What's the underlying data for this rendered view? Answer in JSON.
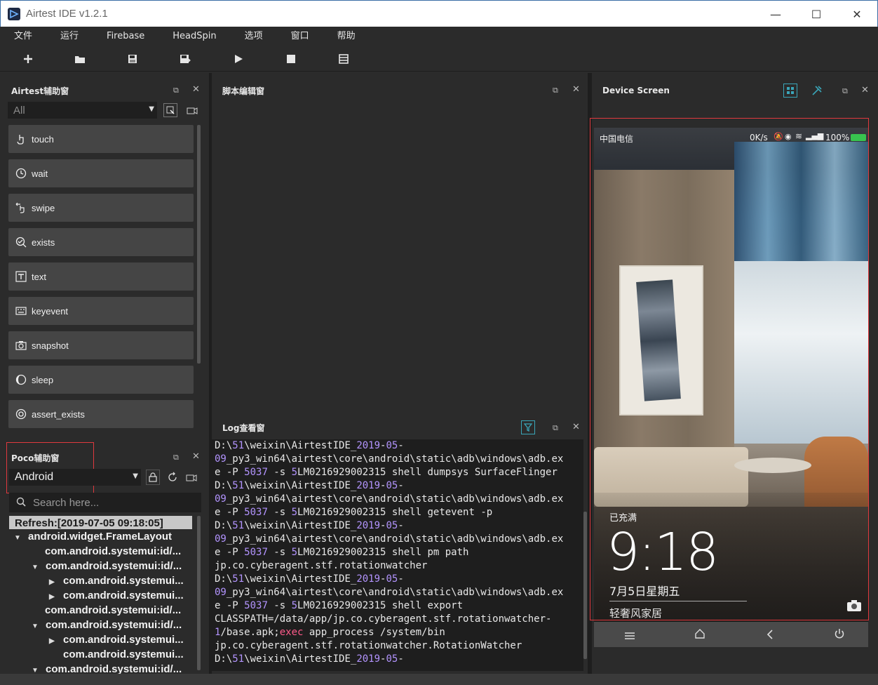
{
  "window": {
    "title": "Airtest IDE v1.2.1"
  },
  "menu": [
    "文件",
    "运行",
    "Firebase",
    "HeadSpin",
    "选项",
    "窗口",
    "帮助"
  ],
  "airtest_panel": {
    "title": "Airtest辅助窗",
    "filter_value": "All",
    "items": [
      "touch",
      "wait",
      "swipe",
      "exists",
      "text",
      "keyevent",
      "snapshot",
      "sleep",
      "assert_exists"
    ]
  },
  "poco_panel": {
    "title": "Poco辅助窗",
    "mode_value": "Android",
    "search_placeholder": "Search here...",
    "refresh_label": "Refresh:[2019-07-05 09:18:05]",
    "tree": [
      {
        "label": "android.widget.FrameLayout",
        "level": 0,
        "arrow": "▼"
      },
      {
        "label": "com.android.systemui:id/...",
        "level": 2,
        "arrow": ""
      },
      {
        "label": "com.android.systemui:id/...",
        "level": 1,
        "arrow": "▼"
      },
      {
        "label": "com.android.systemui...",
        "level": 2,
        "arrow": "▶"
      },
      {
        "label": "com.android.systemui...",
        "level": 2,
        "arrow": "▶"
      },
      {
        "label": "com.android.systemui:id/...",
        "level": 2,
        "arrow": ""
      },
      {
        "label": "com.android.systemui:id/...",
        "level": 1,
        "arrow": "▼"
      },
      {
        "label": "com.android.systemui...",
        "level": 2,
        "arrow": "▶"
      },
      {
        "label": "com.android.systemui...",
        "level": 3,
        "arrow": ""
      },
      {
        "label": "com.android.systemui:id/...",
        "level": 1,
        "arrow": "▼"
      }
    ]
  },
  "script_panel": {
    "title": "脚本编辑窗"
  },
  "log_panel": {
    "title": "Log查看窗",
    "lines": [
      [
        {
          "t": "D:\\"
        },
        {
          "t": "51",
          "c": "num"
        },
        {
          "t": "\\weixin\\AirtestIDE_"
        },
        {
          "t": "2019",
          "c": "num"
        },
        {
          "t": "-"
        },
        {
          "t": "05",
          "c": "num"
        },
        {
          "t": "-"
        }
      ],
      [
        {
          "t": "09",
          "c": "num"
        },
        {
          "t": "_py3_win64\\airtest\\core\\android\\static\\adb\\windows\\adb.ex"
        }
      ],
      [
        {
          "t": "e -P "
        },
        {
          "t": "5037",
          "c": "num"
        },
        {
          "t": " -s "
        },
        {
          "t": "5",
          "c": "num"
        },
        {
          "t": "LM0216929002315 shell dumpsys SurfaceFlinger"
        }
      ],
      [
        {
          "t": "D:\\"
        },
        {
          "t": "51",
          "c": "num"
        },
        {
          "t": "\\weixin\\AirtestIDE_"
        },
        {
          "t": "2019",
          "c": "num"
        },
        {
          "t": "-"
        },
        {
          "t": "05",
          "c": "num"
        },
        {
          "t": "-"
        }
      ],
      [
        {
          "t": "09",
          "c": "num"
        },
        {
          "t": "_py3_win64\\airtest\\core\\android\\static\\adb\\windows\\adb.ex"
        }
      ],
      [
        {
          "t": "e -P "
        },
        {
          "t": "5037",
          "c": "num"
        },
        {
          "t": " -s "
        },
        {
          "t": "5",
          "c": "num"
        },
        {
          "t": "LM0216929002315 shell getevent -p"
        }
      ],
      [
        {
          "t": "D:\\"
        },
        {
          "t": "51",
          "c": "num"
        },
        {
          "t": "\\weixin\\AirtestIDE_"
        },
        {
          "t": "2019",
          "c": "num"
        },
        {
          "t": "-"
        },
        {
          "t": "05",
          "c": "num"
        },
        {
          "t": "-"
        }
      ],
      [
        {
          "t": "09",
          "c": "num"
        },
        {
          "t": "_py3_win64\\airtest\\core\\android\\static\\adb\\windows\\adb.ex"
        }
      ],
      [
        {
          "t": "e -P "
        },
        {
          "t": "5037",
          "c": "num"
        },
        {
          "t": " -s "
        },
        {
          "t": "5",
          "c": "num"
        },
        {
          "t": "LM0216929002315 shell pm path"
        }
      ],
      [
        {
          "t": "jp.co.cyberagent.stf.rotationwatcher"
        }
      ],
      [
        {
          "t": "D:\\"
        },
        {
          "t": "51",
          "c": "num"
        },
        {
          "t": "\\weixin\\AirtestIDE_"
        },
        {
          "t": "2019",
          "c": "num"
        },
        {
          "t": "-"
        },
        {
          "t": "05",
          "c": "num"
        },
        {
          "t": "-"
        }
      ],
      [
        {
          "t": "09",
          "c": "num"
        },
        {
          "t": "_py3_win64\\airtest\\core\\android\\static\\adb\\windows\\adb.ex"
        }
      ],
      [
        {
          "t": "e -P "
        },
        {
          "t": "5037",
          "c": "num"
        },
        {
          "t": " -s "
        },
        {
          "t": "5",
          "c": "num"
        },
        {
          "t": "LM0216929002315 shell export"
        }
      ],
      [
        {
          "t": "CLASSPATH=/data/app/jp.co.cyberagent.stf.rotationwatcher-"
        }
      ],
      [
        {
          "t": "1",
          "c": "num"
        },
        {
          "t": "/base.apk;"
        },
        {
          "t": "exec",
          "c": "kw"
        },
        {
          "t": " app_process /system/bin"
        }
      ],
      [
        {
          "t": "jp.co.cyberagent.stf.rotationwatcher.RotationWatcher"
        }
      ],
      [
        {
          "t": "D:\\"
        },
        {
          "t": "51",
          "c": "num"
        },
        {
          "t": "\\weixin\\AirtestIDE_"
        },
        {
          "t": "2019",
          "c": "num"
        },
        {
          "t": "-"
        },
        {
          "t": "05",
          "c": "num"
        },
        {
          "t": "-"
        }
      ]
    ]
  },
  "device_panel": {
    "title": "Device Screen",
    "status": {
      "carrier": "中国电信",
      "speed": "0K/s",
      "battery": "100%"
    },
    "lock": {
      "charging": "已充满",
      "time": "9:18",
      "date": "7月5日星期五",
      "caption": "轻奢风家居"
    }
  },
  "colors": {
    "accent_red": "#e0393e",
    "toolbar_bg": "#2b2b2b",
    "button_bg": "#454545",
    "icon_teal": "#3aa6b9"
  }
}
